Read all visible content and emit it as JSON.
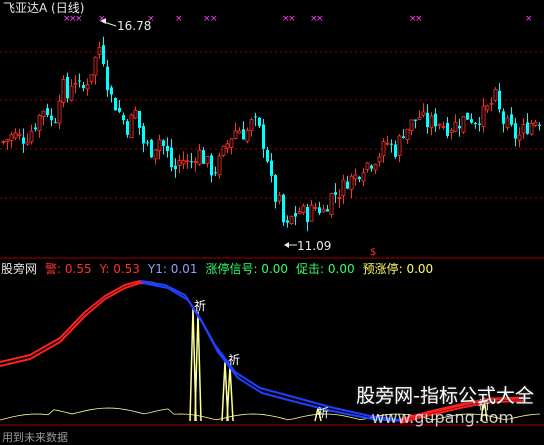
{
  "window": {
    "title": "飞亚达A (日线)"
  },
  "main_chart": {
    "high_label": "16.78",
    "low_label": "11.09",
    "marker_symbol": "$"
  },
  "indicator": {
    "name": "股旁网",
    "items": [
      {
        "label": "警:",
        "value": "0.55",
        "color": "#ff3030"
      },
      {
        "label": "Y:",
        "value": "0.53",
        "color": "#ff3030"
      },
      {
        "label": "Y1:",
        "value": "0.01",
        "color": "#8fa0ff"
      },
      {
        "label": "涨停信号:",
        "value": "0.00",
        "color": "#33ff66"
      },
      {
        "label": "促击:",
        "value": "0.00",
        "color": "#33ff66"
      },
      {
        "label": "预涨停:",
        "value": "0.00",
        "color": "#ffff66"
      }
    ],
    "signal_label": "祈"
  },
  "watermark": {
    "text": "股旁网-指标公式大全",
    "url": "www.gupang.com"
  },
  "footer": {
    "text": "用到未来数据"
  },
  "colors": {
    "up": "#ff3030",
    "down": "#00ffff",
    "red_line": "#ff2020",
    "blue_line": "#2040ff",
    "yellow": "#ffff99",
    "magenta": "#ff40ff",
    "grid": "#a00000"
  },
  "chart_data": {
    "type": "candlestick",
    "high": 16.78,
    "low": 11.09
  }
}
